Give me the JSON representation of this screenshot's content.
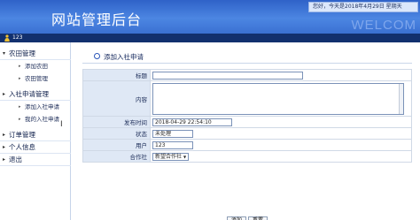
{
  "header": {
    "title": "网站管理后台",
    "welcome_text": "WELCOM",
    "date_text": "您好，今天是2018年4月29日 星期天"
  },
  "userbar": {
    "username": "123",
    "icon": "user-icon"
  },
  "sidebar": {
    "groups": [
      {
        "label": "农田管理",
        "items": [
          "添加农田",
          "农田管理"
        ]
      },
      {
        "label": "入社申请管理",
        "items": [
          "添加入社申请",
          "我的入社申请"
        ]
      },
      {
        "label": "订单管理",
        "items": []
      },
      {
        "label": "个人信息",
        "items": []
      },
      {
        "label": "退出",
        "items": []
      }
    ]
  },
  "form": {
    "section_title": "添加入社申请",
    "fields": {
      "title_label": "标题",
      "title_value": "",
      "content_label": "内容",
      "content_value": "",
      "publish_time_label": "发布时间",
      "publish_time_value": "2018-04-29 22:54:10",
      "status_label": "状态",
      "status_value": "未处理",
      "user_label": "用户",
      "user_value": "123",
      "coop_label": "合作社",
      "coop_value": "新望合作社"
    },
    "buttons": {
      "add": "添加",
      "reset": "重置"
    }
  },
  "colors": {
    "header_blue": "#3a70d2",
    "userbar_navy": "#12306e",
    "label_bg": "#dfe8f5"
  }
}
